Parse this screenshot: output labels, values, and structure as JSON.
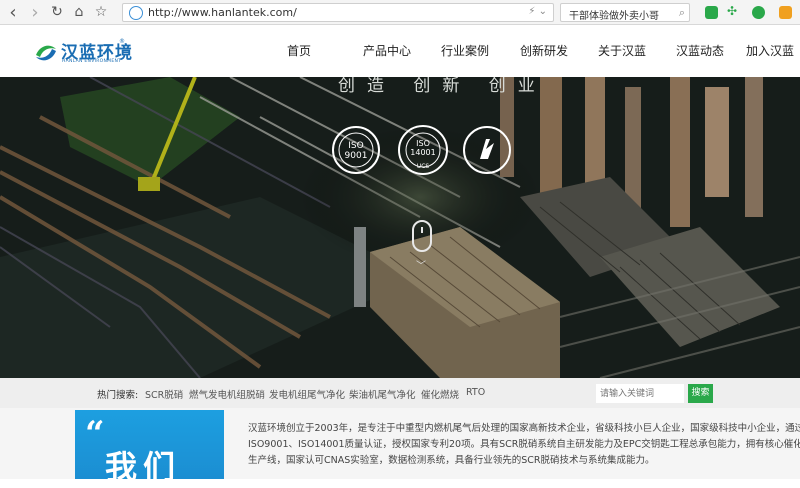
{
  "browser": {
    "back_icon": "‹",
    "forward_icon": "›",
    "reload_icon": "↻",
    "home_icon": "⌂",
    "star_icon": "☆",
    "url": "http://www.hanlantek.com/",
    "search_text": "干部体验做外卖小哥"
  },
  "site": {
    "logo_text": "汉蓝环境",
    "logo_sub": "HANLAN ENVIRONMENT",
    "logo_reg": "®",
    "nav": [
      "首页",
      "产品中心",
      "行业案例",
      "创新研发",
      "关于汉蓝",
      "汉蓝动态",
      "加入汉蓝"
    ]
  },
  "hero": {
    "slogan": "创造 创新 创业",
    "cert1_top": "ISO",
    "cert1_num": "9001",
    "cert2_top": "ISO",
    "cert2_num": "14001",
    "cert2_bottom": "UCS",
    "scroll_arrow": "﹀"
  },
  "hot": {
    "label": "热门搜索:",
    "keywords": [
      "SCR脱硝",
      "燃气发电机组脱硝",
      "发电机组尾气净化",
      "柴油机尾气净化",
      "催化燃烧",
      "RTO"
    ],
    "input_placeholder": "请输入关键词",
    "button": "搜索"
  },
  "intro": {
    "quote_mark": "“",
    "about_word": "我们",
    "line1": "汉蓝环境创立于2003年，是专注于中重型内燃机尾气后处理的国家高新技术企业，省级科技小巨人企业，国家级科技中小企业，通过",
    "line2": "ISO9001、ISO14001质量认证，授权国家专利20项。具有SCR脱硝系统自主研发能力及EPC交钥匙工程总承包能力，拥有核心催化剂",
    "line3": "生产线，国家认可CNAS实验室，数据检测系统，具备行业领先的SCR脱硝技术与系统集成能力。"
  },
  "colors": {
    "brand": "#1a6db3",
    "search_button": "#2aa84a",
    "about_box": "#1d9fe0"
  }
}
